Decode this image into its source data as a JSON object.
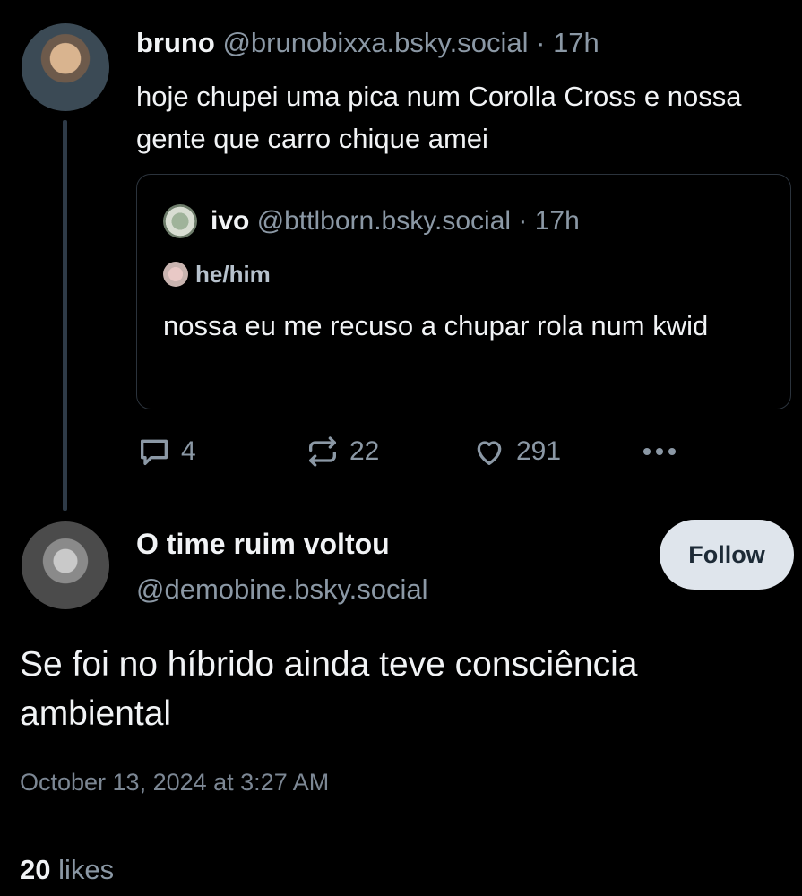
{
  "parent_post": {
    "author_name": "bruno",
    "handle": "@brunobixxa.bsky.social",
    "separator": "·",
    "age": "17h",
    "text": "hoje chupei uma pica num Corolla Cross e nossa gente que carro chique amei",
    "quote": {
      "author_name": "ivo",
      "handle": "@bttlborn.bsky.social",
      "separator": "·",
      "age": "17h",
      "pronouns": "he/him",
      "text": "nossa eu me recuso a chupar rola num kwid"
    },
    "actions": {
      "reply_count": "4",
      "repost_count": "22",
      "like_count": "291"
    }
  },
  "main_post": {
    "author_name": "O time ruim voltou",
    "handle": "@demobine.bsky.social",
    "follow_label": "Follow",
    "text": "Se foi no híbrido ainda teve consciência ambiental",
    "timestamp": "October 13, 2024 at 3:27 AM",
    "likes_count": "20",
    "likes_label": "likes"
  },
  "colors": {
    "background": "#000000",
    "muted_text": "#8b98a5",
    "follow_button_bg": "#dfe5ec"
  },
  "icons": [
    "reply-icon",
    "repost-icon",
    "like-icon",
    "more-icon"
  ]
}
